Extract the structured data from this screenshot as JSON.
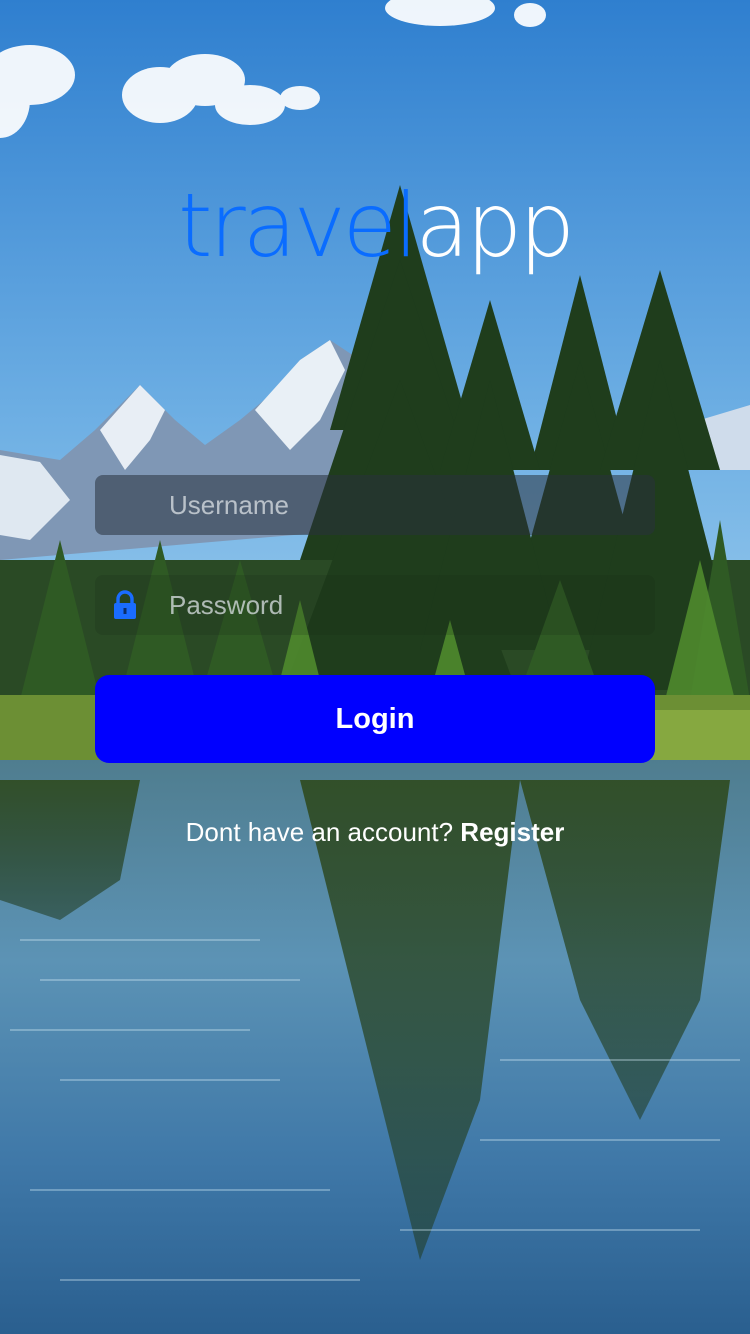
{
  "logo": {
    "part1": "travel",
    "part2": "app",
    "part1_color": "#0a6cff",
    "part2_color": "#ffffff"
  },
  "form": {
    "username_placeholder": "Username",
    "username_value": "",
    "password_placeholder": "Password",
    "password_value": "",
    "password_icon": "lock-icon",
    "login_label": "Login",
    "login_color": "#0000ff"
  },
  "register": {
    "prompt": "Dont have an account? ",
    "link": "Register"
  },
  "background": {
    "description_icon": "landscape-background"
  }
}
